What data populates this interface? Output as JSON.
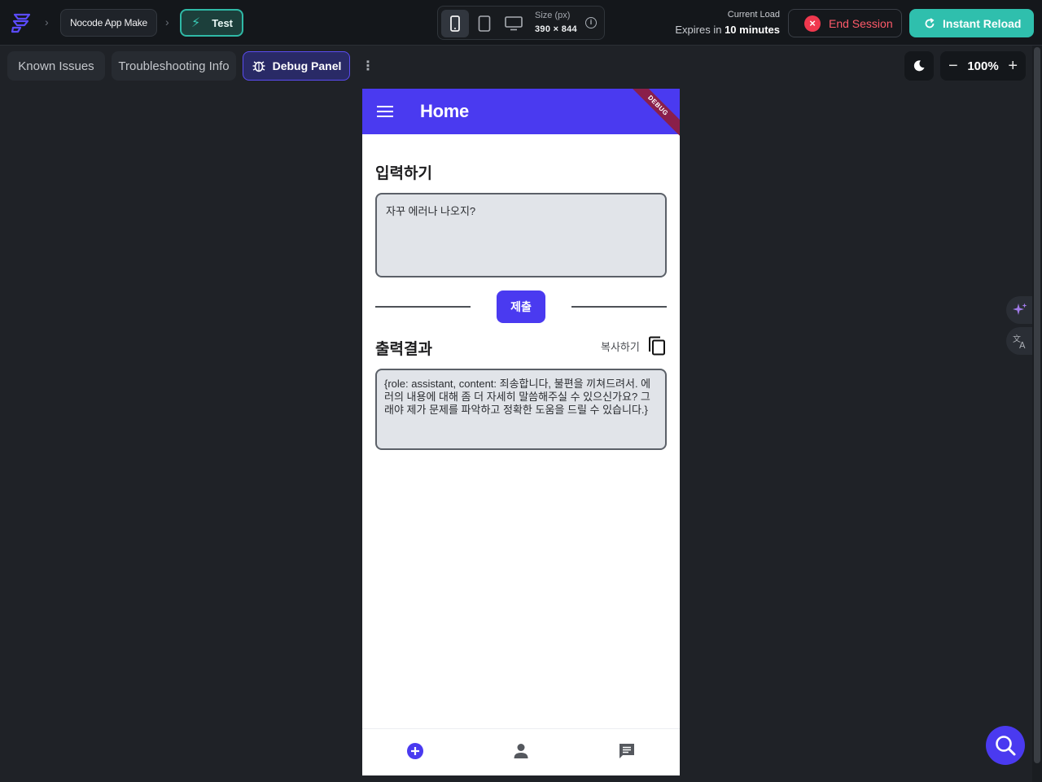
{
  "topbar": {
    "project_name": "Nocode App Make",
    "mode_label": "Test",
    "size_label": "Size (px)",
    "size_value": "390 × 844",
    "load_label": "Current Load",
    "expires_prefix": "Expires in",
    "expires_value": "10 minutes",
    "end_session_label": "End Session",
    "instant_reload_label": "Instant Reload",
    "colors": {
      "accent_teal": "#2fbfad",
      "danger": "#f0384e",
      "brand": "#4a3af0"
    }
  },
  "toolbar": {
    "tabs": [
      {
        "label": "Known Issues"
      },
      {
        "label": "Troubleshooting Info"
      },
      {
        "label": "Debug Panel",
        "active": true
      }
    ],
    "zoom_level": "100%"
  },
  "app": {
    "title": "Home",
    "debug_ribbon": "DEBUG",
    "input_section_title": "입력하기",
    "input_value": "자꾸 에러나 나오지?",
    "submit_label": "제출",
    "output_section_title": "출력결과",
    "copy_label": "복사하기",
    "output_value": "{role: assistant, content: 죄송합니다, 불편을 끼쳐드려서. 에러의 내용에 대해 좀 더 자세히 말씀해주실 수 있으신가요? 그래야 제가 문제를 파악하고 정확한 도움을 드릴 수 있습니다.}",
    "bottom_nav": [
      {
        "icon": "add-circle-icon",
        "active": true
      },
      {
        "icon": "person-icon"
      },
      {
        "icon": "chat-icon"
      }
    ]
  }
}
